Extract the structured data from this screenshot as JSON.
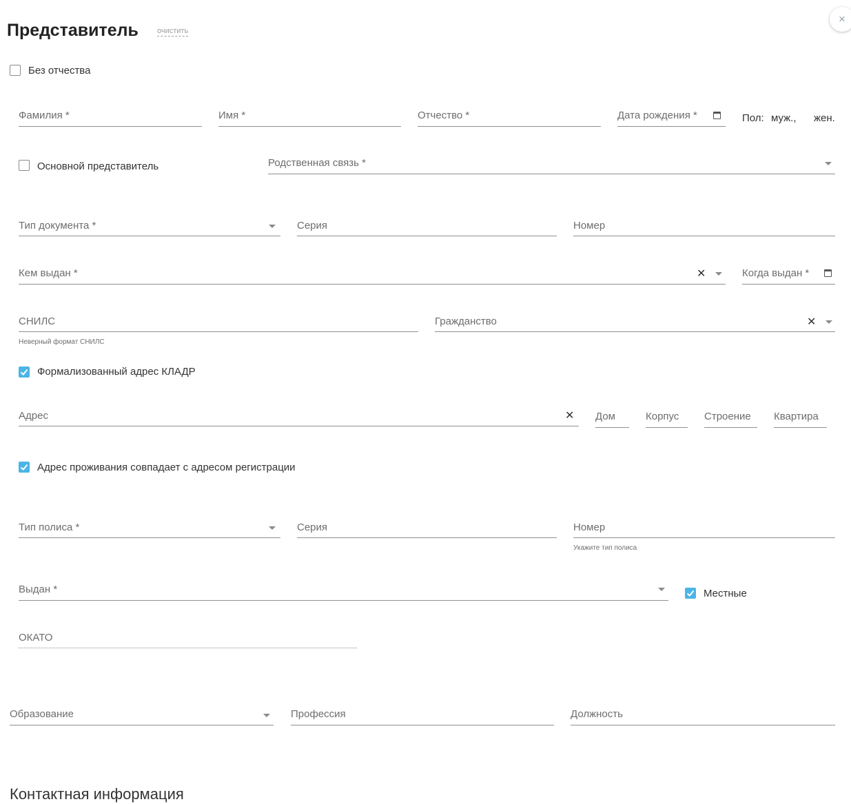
{
  "header": {
    "title": "Представитель",
    "clear_label": "очистить",
    "close_icon": "×"
  },
  "no_patronymic": {
    "label": "Без отчества",
    "checked": false
  },
  "person": {
    "last_name": "Фамилия *",
    "first_name": "Имя *",
    "patronymic": "Отчество *",
    "birth_date": "Дата рождения *",
    "gender_label": "Пол:",
    "gender_male": "муж.,",
    "gender_female": "жен."
  },
  "main_rep": {
    "label": "Основной представитель",
    "checked": false
  },
  "relation": {
    "label": "Родственная связь *"
  },
  "document": {
    "type": "Тип документа *",
    "series": "Серия",
    "number": "Номер",
    "issued_by": "Кем выдан *",
    "issued_when": "Когда выдан *"
  },
  "snils": {
    "label": "СНИЛС",
    "hint": "Неверный формат СНИЛС"
  },
  "citizenship": {
    "label": "Гражданство"
  },
  "kladr": {
    "label": "Формализованный адрес КЛАДР",
    "checked": true
  },
  "address": {
    "label": "Адрес",
    "house": "Дом",
    "building": "Корпус",
    "structure": "Строение",
    "apartment": "Квартира"
  },
  "same_address": {
    "label": "Адрес проживания совпадает с адресом регистрации",
    "checked": true
  },
  "policy": {
    "type": "Тип полиса *",
    "series": "Серия",
    "number": "Номер",
    "hint": "Укажите тип полиса",
    "issued": "Выдан *",
    "local_label": "Местные",
    "local_checked": true,
    "okato": "ОКАТО"
  },
  "work": {
    "education": "Образование",
    "profession": "Профессия",
    "position": "Должность"
  },
  "contacts_title": "Контактная информация",
  "colors": {
    "accent": "#4ab5e6",
    "line": "#8f8f8f",
    "label": "#6d6d6d"
  }
}
